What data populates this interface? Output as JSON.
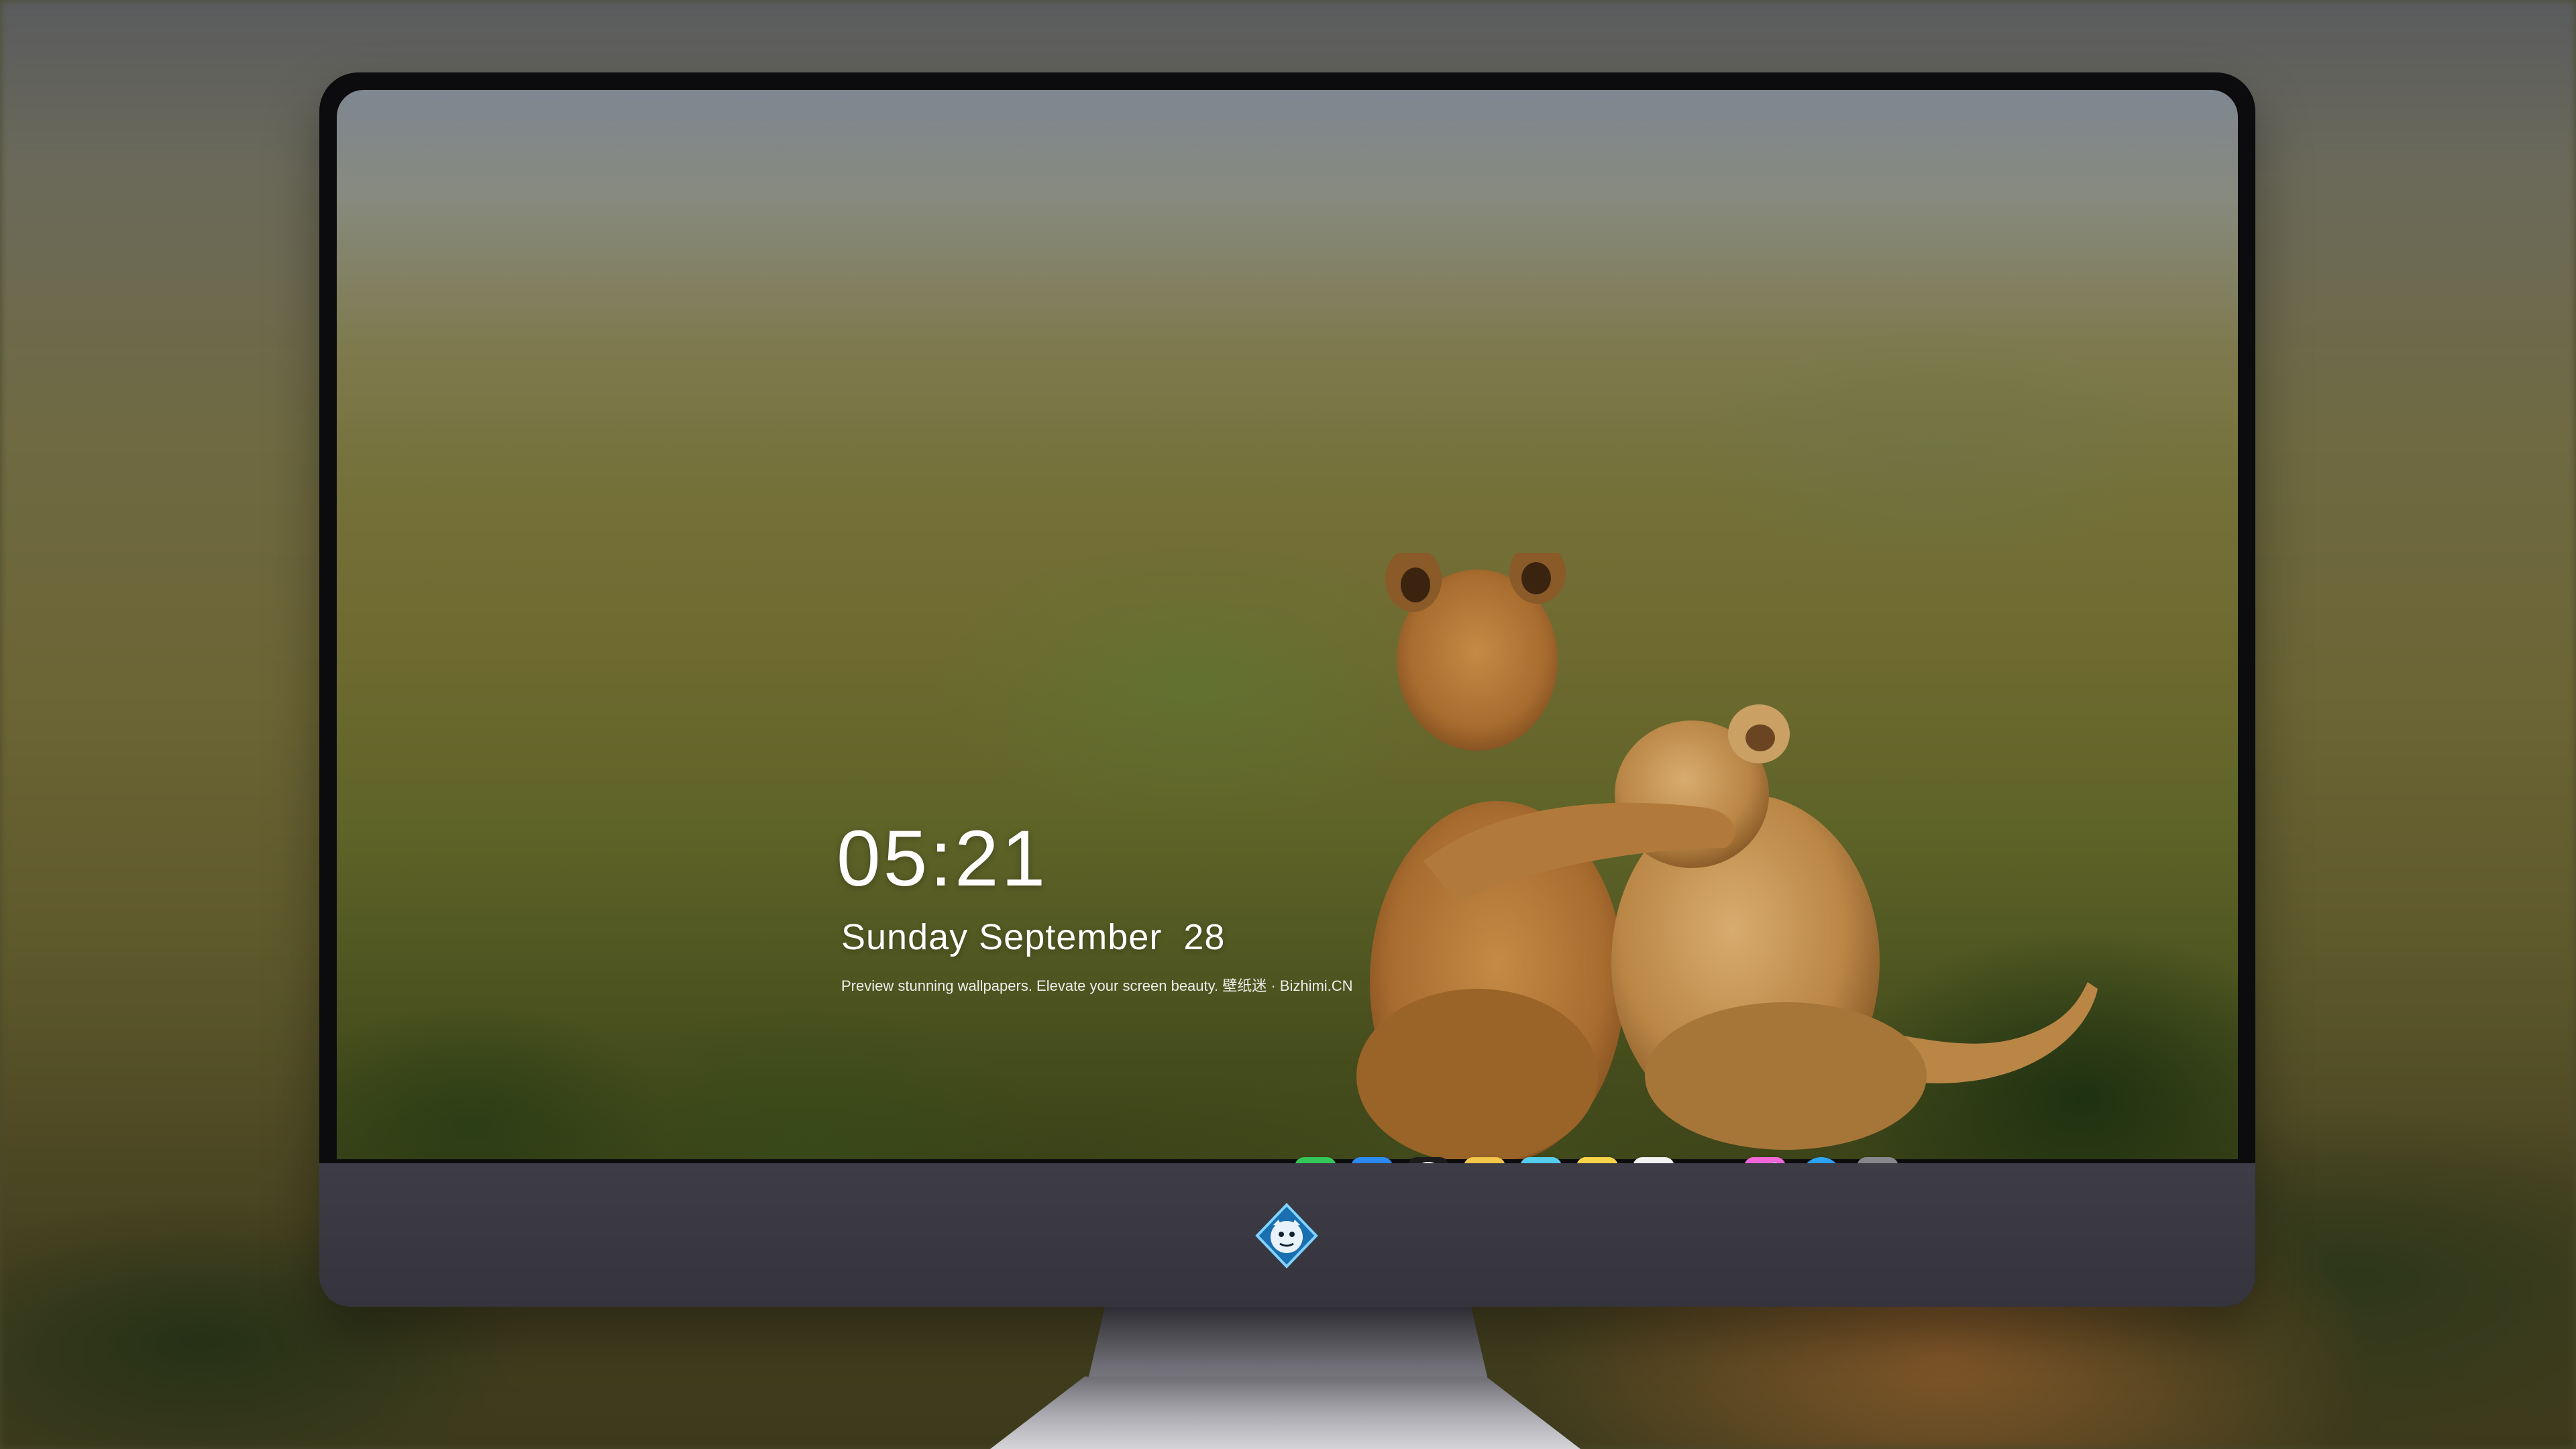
{
  "lockscreen": {
    "time": "05:21",
    "date": "Sunday September  28",
    "tagline": "Preview stunning wallpapers. Elevate your screen beauty. 壁纸迷 · Bizhimi.CN"
  },
  "dock": {
    "apps": [
      {
        "name": "messages",
        "icon": "messages-icon",
        "color": "#34c759"
      },
      {
        "name": "weather",
        "icon": "weather-icon",
        "color": "#2f8cf5"
      },
      {
        "name": "clock",
        "icon": "clock-icon",
        "color": "#1c1c1e"
      },
      {
        "name": "preview",
        "icon": "preview-icon",
        "color": "#f3c64a"
      },
      {
        "name": "clips",
        "icon": "clapperboard-icon",
        "color": "#4fc3e8"
      },
      {
        "name": "notes",
        "icon": "notes-icon",
        "color": "#fde27a"
      },
      {
        "name": "calendar",
        "icon": "calendar-icon",
        "color": "#f2f2f2"
      },
      {
        "name": "music",
        "icon": "music-icon",
        "color": "#f03ec7"
      },
      {
        "name": "app-store",
        "icon": "app-store-icon",
        "color": "#1e88f5"
      },
      {
        "name": "camera",
        "icon": "camera-icon",
        "color": "#6f7074"
      }
    ]
  },
  "device": {
    "chin_logo": "monster-logo-icon"
  }
}
